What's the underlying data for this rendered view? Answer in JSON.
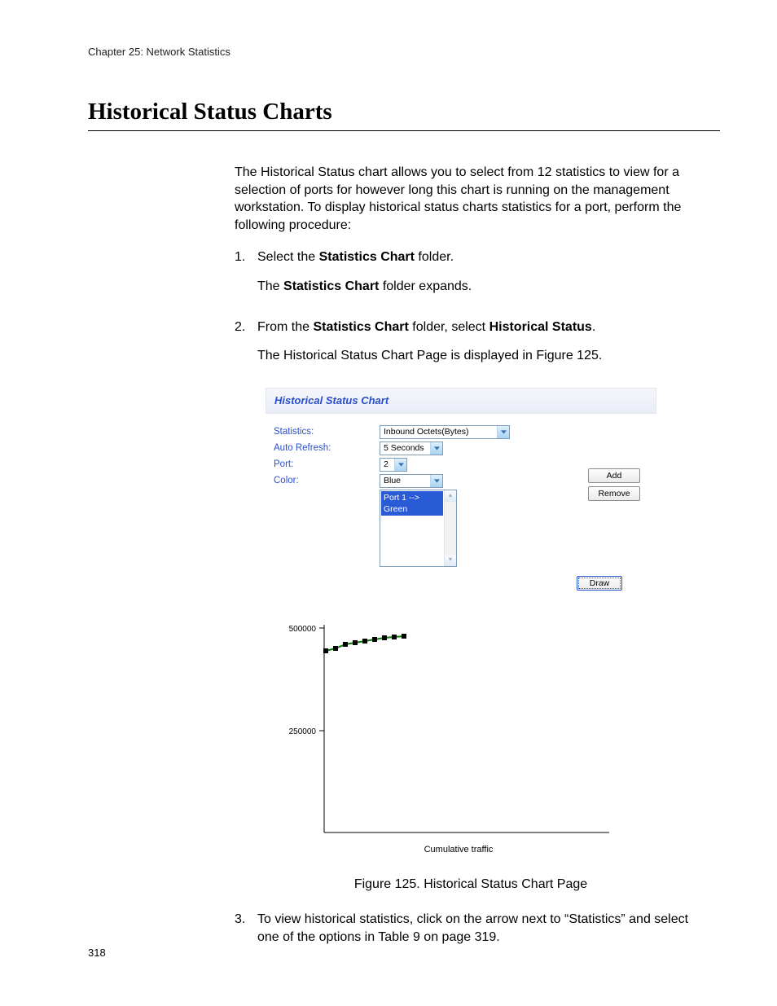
{
  "chapter": "Chapter 25: Network Statistics",
  "section_title": "Historical Status Charts",
  "intro": "The Historical Status chart allows you to select from 12 statistics to view for a selection of ports for however long this chart is running on the management workstation. To display historical status charts statistics for a port, perform the following procedure:",
  "steps": {
    "s1": {
      "num": "1.",
      "line1_a": "Select the ",
      "line1_b": "Statistics Chart",
      "line1_c": " folder.",
      "line2_a": "The ",
      "line2_b": "Statistics Chart",
      "line2_c": " folder expands."
    },
    "s2": {
      "num": "2.",
      "line1_a": "From the ",
      "line1_b": "Statistics Chart",
      "line1_c": " folder, select ",
      "line1_d": "Historical Status",
      "line1_e": ".",
      "line2": "The Historical Status Chart Page is displayed in Figure 125."
    },
    "s3": {
      "num": "3.",
      "text": "To view historical statistics, click on the arrow next to “Statistics” and select one of the options in Table 9 on page 319."
    }
  },
  "panel": {
    "title": "Historical Status Chart",
    "labels": {
      "statistics": "Statistics:",
      "auto_refresh": "Auto Refresh:",
      "port": "Port:",
      "color": "Color:"
    },
    "values": {
      "statistics": "Inbound Octets(Bytes)",
      "auto_refresh": "5 Seconds",
      "port": "2",
      "color": "Blue",
      "list_item": "Port 1 --> Green"
    },
    "buttons": {
      "add": "Add",
      "remove": "Remove",
      "draw": "Draw"
    }
  },
  "chart_data": {
    "type": "line",
    "title": "",
    "xlabel": "Cumulative traffic",
    "ylabel": "",
    "ylim": [
      0,
      500000
    ],
    "yticks": [
      250000,
      500000
    ],
    "ytick_labels": [
      "250000",
      "500000"
    ],
    "series": [
      {
        "name": "Port 1",
        "color": "#0a7d0a",
        "x": [
          0,
          1,
          2,
          3,
          4,
          5,
          6,
          7,
          8
        ],
        "values": [
          445000,
          450000,
          460000,
          465000,
          468000,
          472000,
          476000,
          478000,
          480000
        ]
      }
    ]
  },
  "figure_caption": "Figure 125. Historical Status Chart Page",
  "page_number": "318"
}
